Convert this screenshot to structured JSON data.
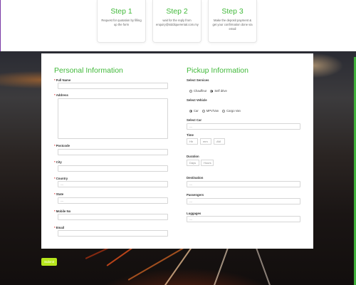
{
  "steps": [
    {
      "title": "Step 1",
      "desc": "Request for quotation by filling up the form"
    },
    {
      "title": "Step 2",
      "desc": "wait for the reply from enquiry@siddiquerental.com.my"
    },
    {
      "title": "Step 3",
      "desc": "Make the deposit payment & get your confirmation done via email"
    }
  ],
  "personal": {
    "title": "Personal Information",
    "full_name": "Full Name",
    "address": "Address",
    "postcode": "Postcode",
    "city": "City",
    "country": "Country",
    "country_value": "---",
    "state": "State",
    "state_value": "---",
    "mobile": "Mobile No",
    "email": "Email"
  },
  "pickup": {
    "title": "Pickup Information",
    "services_label": "Select Services",
    "services": [
      "Chauffeur",
      "Self drive"
    ],
    "vehicle_label": "Select Vehicle",
    "vehicles": [
      "Car",
      "MPV/Van",
      "Cargo Van"
    ],
    "car_label": "Select Car",
    "car_value": "---",
    "time_label": "Time",
    "time_hh": "Hh",
    "time_mm": "mm",
    "time_ampm": "AM",
    "duration_label": "Duration",
    "duration_days": "Days",
    "duration_hours": "Hours",
    "destination_label": "Destination",
    "destination_value": "---",
    "passengers_label": "Passengers",
    "passengers_value": "---",
    "luggages_label": "Luggages",
    "luggages_value": "---"
  },
  "submit_label": "Submit",
  "colors": {
    "accent": "#41b93a",
    "button": "#b7e61d"
  }
}
